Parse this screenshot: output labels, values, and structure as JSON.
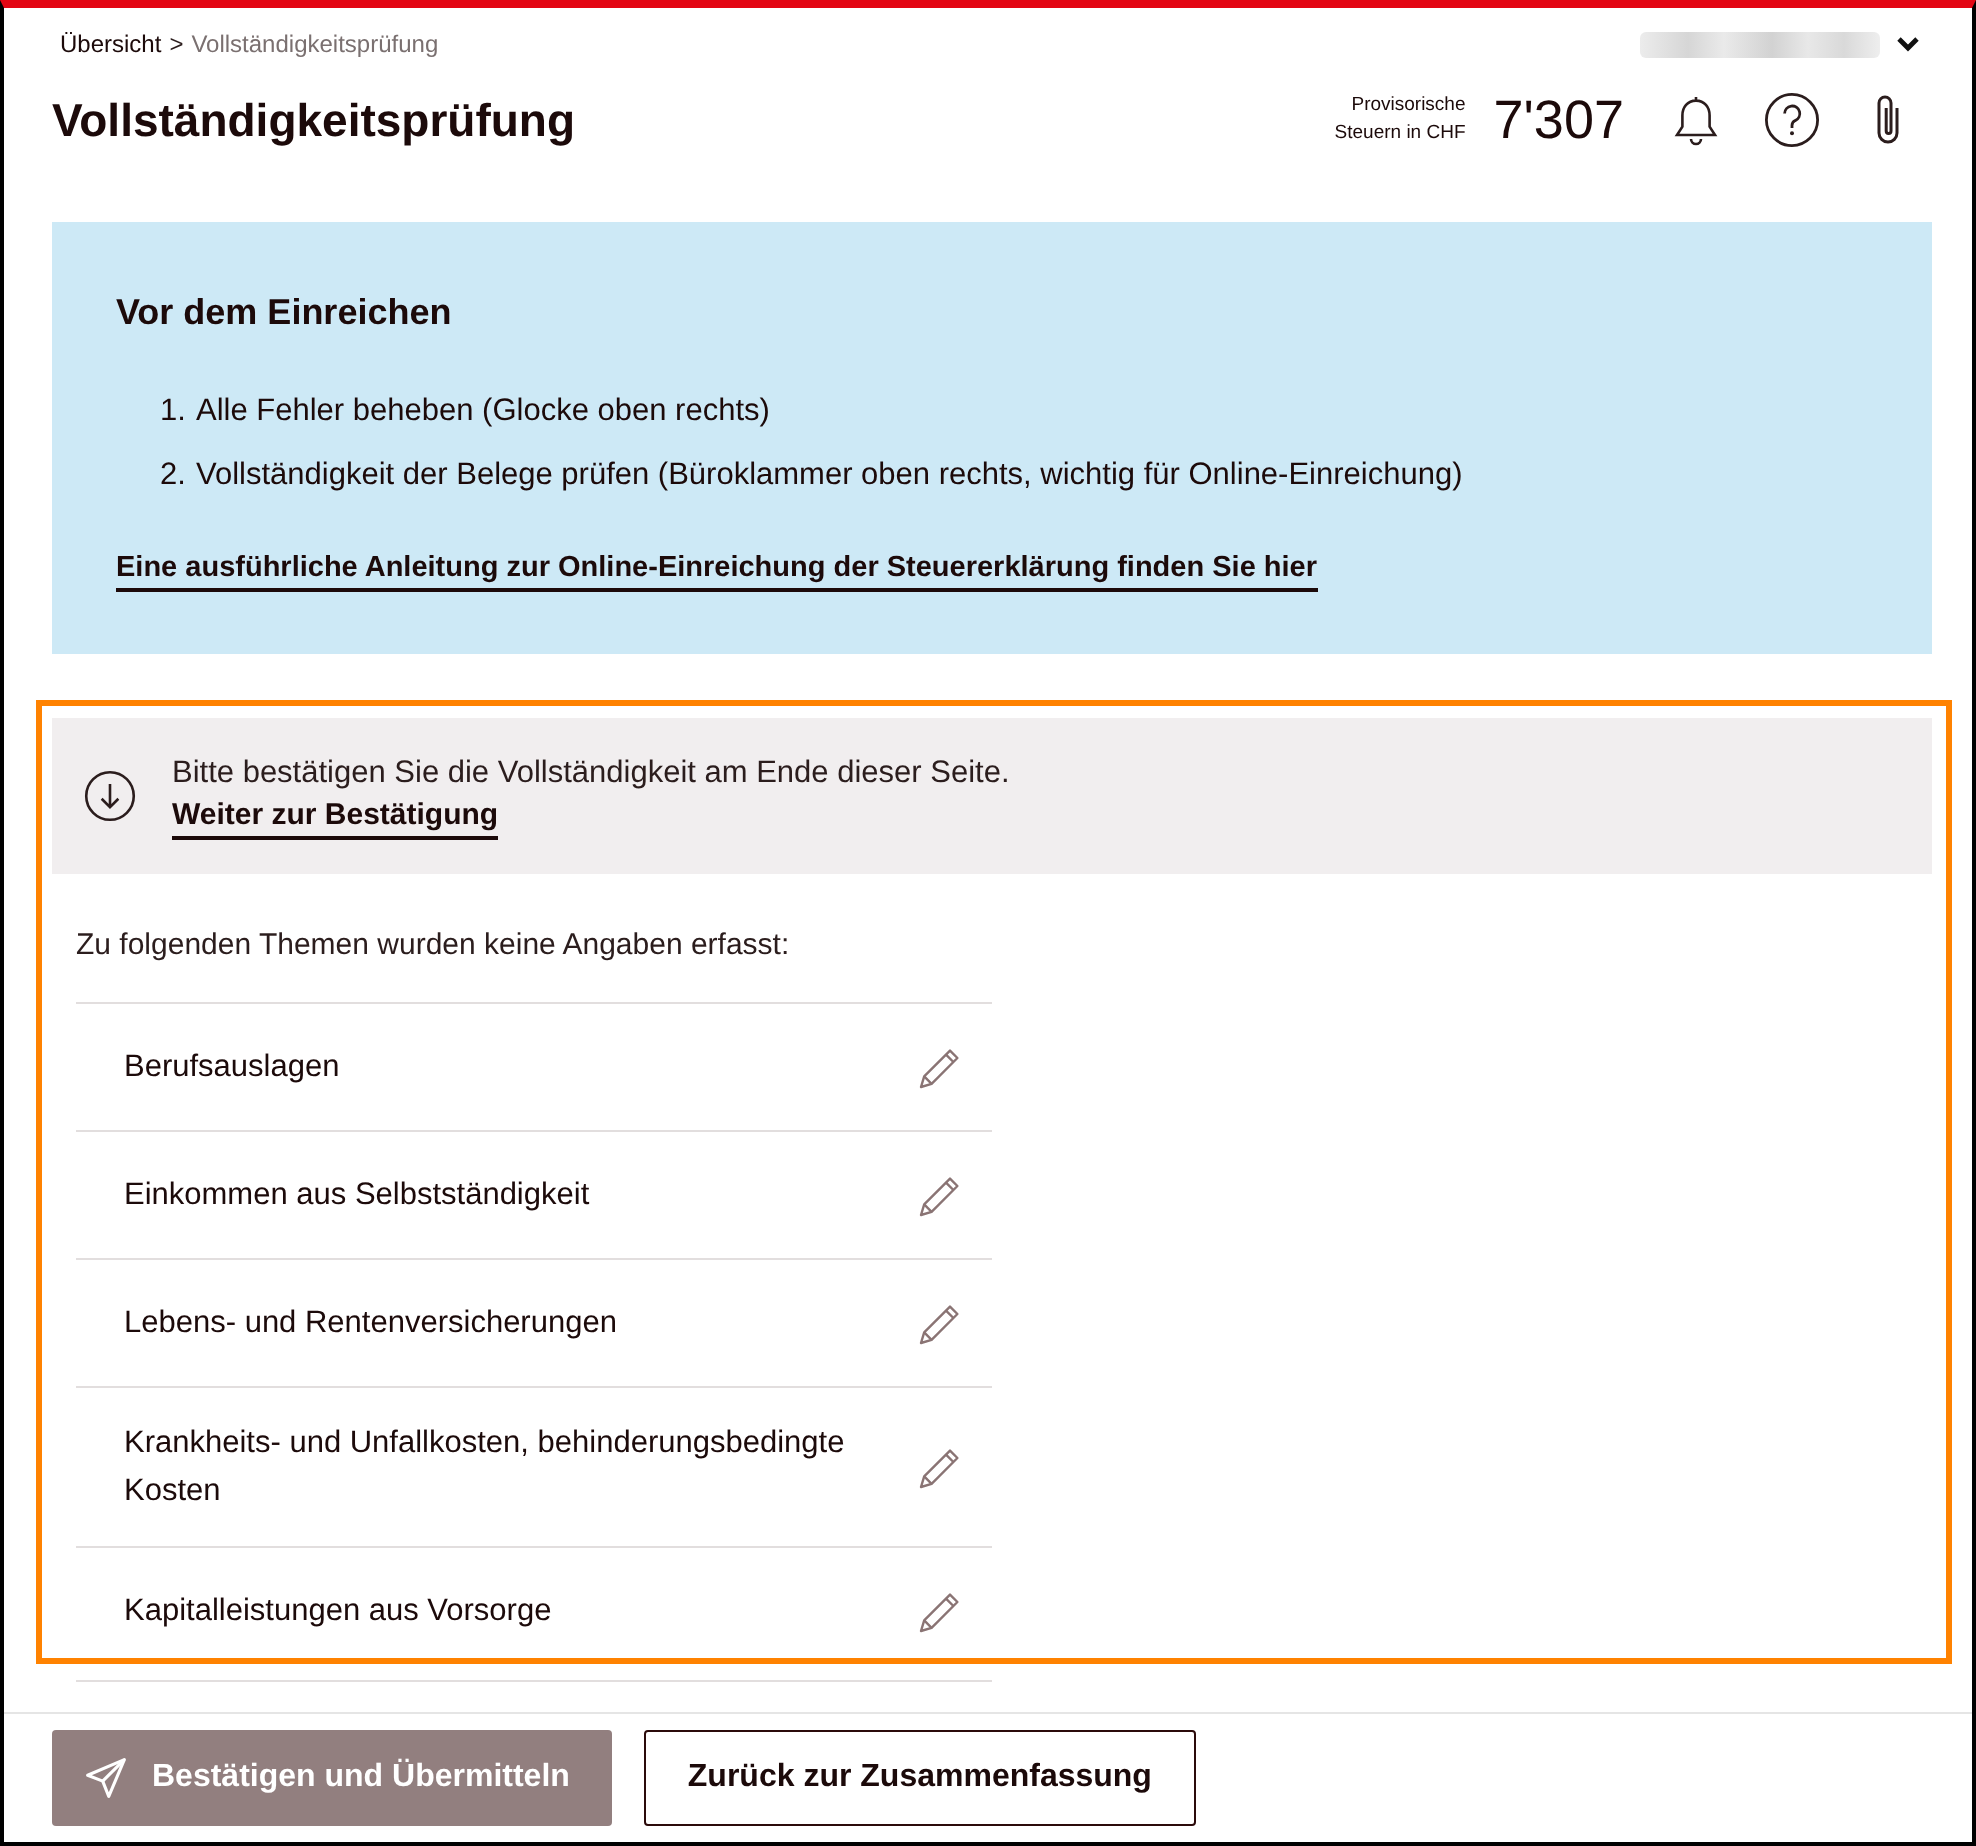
{
  "breadcrumb": {
    "items": [
      {
        "label": "Übersicht",
        "current": false
      },
      {
        "label": "Vollständigkeitsprüfung",
        "current": true
      }
    ],
    "separator": ">"
  },
  "page_title": "Vollständigkeitsprüfung",
  "tax_estimate": {
    "label": "Provisorische Steuern in CHF",
    "amount": "7'307"
  },
  "info_box": {
    "title": "Vor dem Einreichen",
    "steps": [
      {
        "number": "1.",
        "text": "Alle Fehler beheben (Glocke oben rechts)"
      },
      {
        "number": "2.",
        "text": "Vollständigkeit der Belege prüfen (Büroklammer oben rechts, wichtig für Online-Einreichung)"
      }
    ],
    "link": "Eine ausführliche Anleitung zur Online-Einreichung der Steuererklärung finden Sie hier"
  },
  "completeness_check": {
    "highlighted": true,
    "notice": {
      "text": "Bitte bestätigen Sie die Vollständigkeit am Ende dieser Seite.",
      "link": "Weiter zur Bestätigung"
    },
    "intro": "Zu folgenden Themen wurden keine Angaben erfasst:",
    "topics": [
      {
        "label": "Berufsauslagen"
      },
      {
        "label": "Einkommen aus Selbstständigkeit"
      },
      {
        "label": "Lebens- und Rentenversicherungen"
      },
      {
        "label": "Krankheits- und Unfallkosten, behinderungsbedingte Kosten"
      },
      {
        "label": "Kapitalleistungen aus Vorsorge"
      }
    ]
  },
  "footer": {
    "buttons": [
      {
        "label": "Bestätigen und Übermitteln",
        "kind": "primary",
        "disabled": true
      },
      {
        "label": "Zurück zur Zusammenfassung",
        "kind": "secondary",
        "disabled": false
      }
    ]
  }
}
